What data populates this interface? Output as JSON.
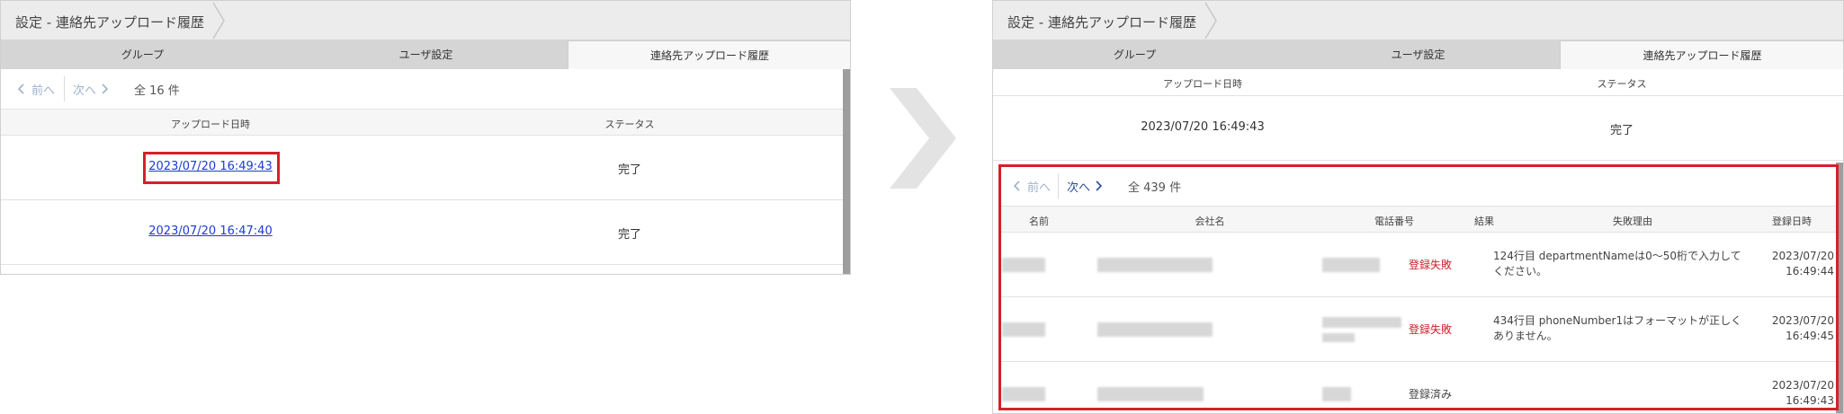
{
  "left": {
    "breadcrumb": "設定 - 連絡先アップロード履歴",
    "tabs": [
      {
        "label": "グループ"
      },
      {
        "label": "ユーザ設定"
      },
      {
        "label": "連絡先アップロード履歴"
      }
    ],
    "pager": {
      "prev": "前へ",
      "next": "次へ",
      "total": "全 16 件"
    },
    "columns": {
      "date": "アップロード日時",
      "status": "ステータス"
    },
    "rows": [
      {
        "date": "2023/07/20 16:49:43",
        "status": "完了"
      },
      {
        "date": "2023/07/20 16:47:40",
        "status": "完了"
      }
    ]
  },
  "right": {
    "breadcrumb": "設定 - 連絡先アップロード履歴",
    "tabs": [
      {
        "label": "グループ"
      },
      {
        "label": "ユーザ設定"
      },
      {
        "label": "連絡先アップロード履歴"
      }
    ],
    "columns": {
      "date": "アップロード日時",
      "status": "ステータス"
    },
    "selected_row": {
      "date": "2023/07/20 16:49:43",
      "status": "完了"
    },
    "detail": {
      "pager": {
        "prev": "前へ",
        "next": "次へ",
        "total": "全 439 件"
      },
      "columns": {
        "name": "名前",
        "company": "会社名",
        "phone": "電話番号",
        "result": "結果",
        "reason": "失敗理由",
        "registered": "登録日時"
      },
      "rows": [
        {
          "result": "登録失敗",
          "reason_line1": "124行目 departmentNameは0～50桁で入力して",
          "reason_line2": "ください。",
          "date": "2023/07/20",
          "time": "16:49:44"
        },
        {
          "result": "登録失敗",
          "reason_line1": "434行目 phoneNumber1はフォーマットが正しく",
          "reason_line2": "ありません。",
          "date": "2023/07/20",
          "time": "16:49:45"
        },
        {
          "result": "登録済み",
          "reason_line1": "",
          "reason_line2": "",
          "date": "2023/07/20",
          "time": "16:49:43"
        }
      ]
    }
  },
  "colors": {
    "highlight": "#d6202a",
    "link": "#1a3bd6",
    "fail": "#c8202a",
    "pager_disabled": "#9fb1cc",
    "pager_enabled": "#2a4f9a"
  },
  "icons": [
    "chevron-left-icon",
    "chevron-right-icon",
    "breadcrumb-chevron-icon",
    "transition-arrow-icon"
  ]
}
